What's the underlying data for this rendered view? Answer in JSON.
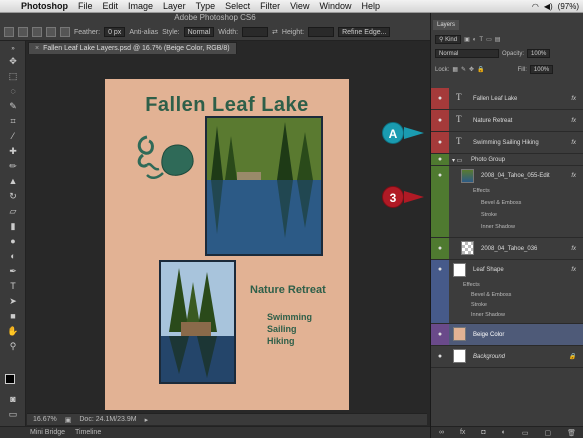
{
  "menubar": {
    "items": [
      "Photoshop",
      "File",
      "Edit",
      "Image",
      "Layer",
      "Type",
      "Select",
      "Filter",
      "View",
      "Window",
      "Help"
    ],
    "battery": "(97%)"
  },
  "window_title": "Adobe Photoshop CS6",
  "options": {
    "feather_label": "Feather:",
    "feather_value": "0 px",
    "antialias_label": "Anti-alias",
    "style_label": "Style:",
    "style_value": "Normal",
    "width_label": "Width:",
    "height_label": "Height:",
    "refine_label": "Refine Edge..."
  },
  "document_tab": "Fallen Leaf Lake Layers.psd @ 16.7% (Beige Color, RGB/8)",
  "document": {
    "title": "Fallen Leaf Lake",
    "subtitle": "Nature Retreat",
    "activities": [
      "Swimming",
      "Sailing",
      "Hiking"
    ]
  },
  "callouts": {
    "a": "A",
    "three": "3"
  },
  "status": {
    "zoom": "16.67%",
    "doc_size": "Doc: 24.1M/23.9M"
  },
  "bottom_tabs": [
    "Mini Bridge",
    "Timeline"
  ],
  "layers_panel": {
    "tab": "Layers",
    "kind": "Kind",
    "blend_mode": "Normal",
    "opacity_label": "Opacity:",
    "opacity_value": "100%",
    "lock_label": "Lock:",
    "fill_label": "Fill:",
    "fill_value": "100%",
    "layers": {
      "fallen_leaf_lake": "Fallen Leaf Lake",
      "nature_retreat": "Nature Retreat",
      "swimming": "Swimming Sailing Hiking",
      "photo_group": "Photo Group",
      "photo1": "2008_04_Tahoe_055-Edit",
      "photo1_effects": [
        "Effects",
        "Bevel & Emboss",
        "Stroke",
        "Inner Shadow"
      ],
      "photo2": "2008_04_Tahoe_036",
      "leaf_shape": "Leaf Shape",
      "leaf_effects": [
        "Effects",
        "Bevel & Emboss",
        "Stroke",
        "Inner Shadow"
      ],
      "beige_color": "Beige Color",
      "background": "Background"
    },
    "fx_label": "fx"
  },
  "colors": {
    "red_label": "#a53a3a",
    "green_label": "#4f7a30",
    "blue_label": "#465a8a",
    "violet_label": "#6a4a8a",
    "doc_bg": "#e2b294",
    "title_green": "#2e5f49"
  }
}
